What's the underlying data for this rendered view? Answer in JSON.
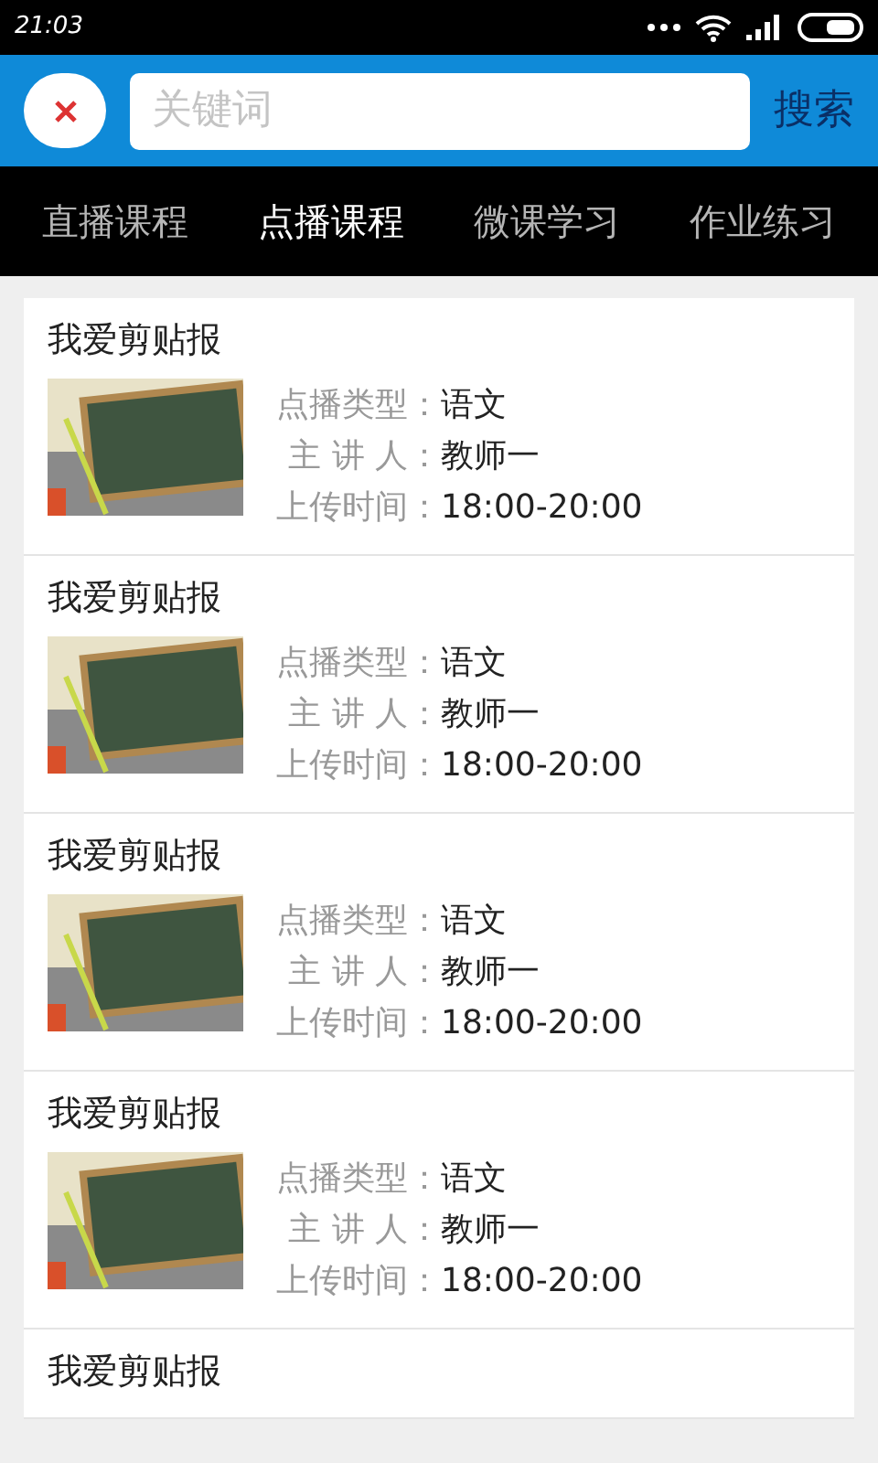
{
  "status_bar": {
    "time": "21:03"
  },
  "search": {
    "placeholder": "关键词",
    "button": "搜索"
  },
  "tabs": [
    {
      "label": "直播课程",
      "selected": false
    },
    {
      "label": "点播课程",
      "selected": true
    },
    {
      "label": "微课学习",
      "selected": false
    },
    {
      "label": "作业练习",
      "selected": false
    }
  ],
  "courses": [
    {
      "title": "我爱剪贴报",
      "fields": [
        {
          "label": "点播类型：",
          "value": "语文"
        },
        {
          "label": "主 讲 人：",
          "value": "教师一"
        },
        {
          "label": "上传时间：",
          "value": "18:00-20:00"
        }
      ]
    },
    {
      "title": "我爱剪贴报",
      "fields": [
        {
          "label": "点播类型：",
          "value": "语文"
        },
        {
          "label": "主 讲 人：",
          "value": "教师一"
        },
        {
          "label": "上传时间：",
          "value": "18:00-20:00"
        }
      ]
    },
    {
      "title": "我爱剪贴报",
      "fields": [
        {
          "label": "点播类型：",
          "value": "语文"
        },
        {
          "label": "主 讲 人：",
          "value": "教师一"
        },
        {
          "label": "上传时间：",
          "value": "18:00-20:00"
        }
      ]
    },
    {
      "title": "我爱剪贴报",
      "fields": [
        {
          "label": "点播类型：",
          "value": "语文"
        },
        {
          "label": "主 讲 人：",
          "value": "教师一"
        },
        {
          "label": "上传时间：",
          "value": "18:00-20:00"
        }
      ]
    },
    {
      "title": "我爱剪贴报"
    }
  ]
}
